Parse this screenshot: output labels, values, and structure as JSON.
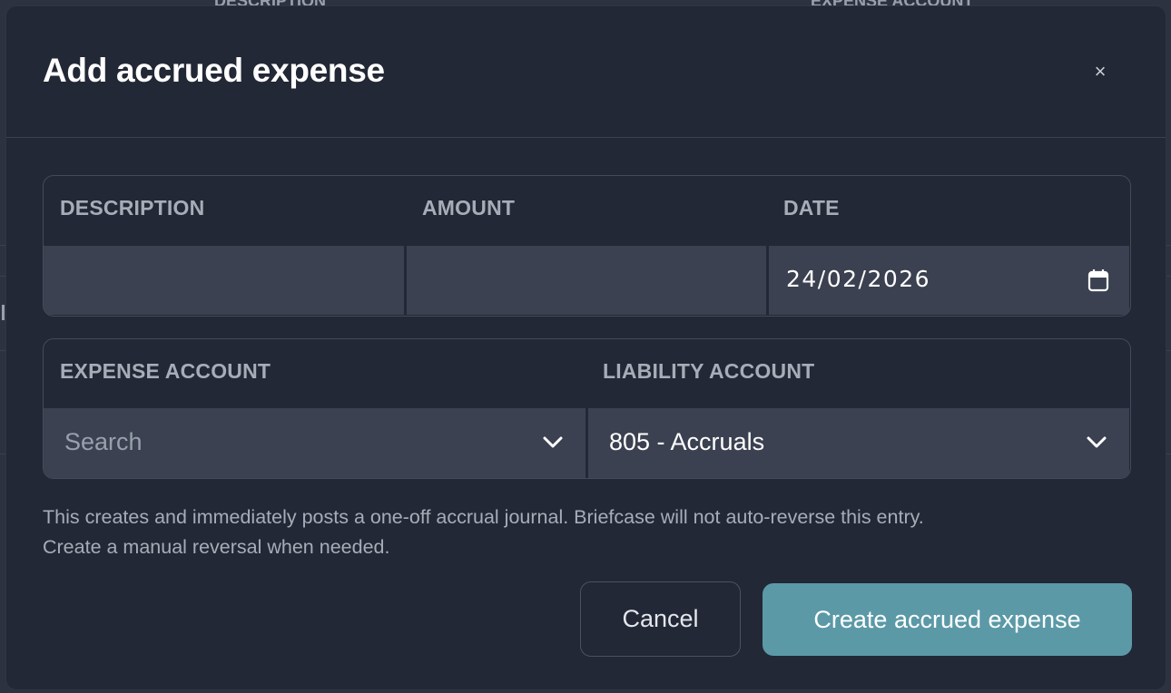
{
  "background": {
    "columns": [
      "DESCRIPTION",
      "EXPENSE ACCOUNT"
    ]
  },
  "modal": {
    "title": "Add accrued expense",
    "close_label": "×",
    "top_row": {
      "labels": [
        "DESCRIPTION",
        "AMOUNT",
        "DATE"
      ],
      "description_value": "",
      "amount_value": "",
      "date_value": "24/02/2026"
    },
    "bottom_row": {
      "labels": [
        "EXPENSE ACCOUNT",
        "LIABILITY ACCOUNT"
      ],
      "expense_placeholder": "Search",
      "liability_value": "805 - Accruals"
    },
    "note_line1": "This creates and immediately posts a one-off accrual journal. Briefcase will not auto-reverse this entry.",
    "note_line2": "Create a manual reversal when needed.",
    "buttons": {
      "cancel": "Cancel",
      "create": "Create accrued expense"
    }
  },
  "colors": {
    "accent": "#5b99a7",
    "modal_bg": "#222835",
    "field_bg": "#3b4150"
  },
  "icons": {
    "close": "close-icon",
    "calendar": "calendar-icon",
    "dropdown": "chevron-down-icon"
  }
}
